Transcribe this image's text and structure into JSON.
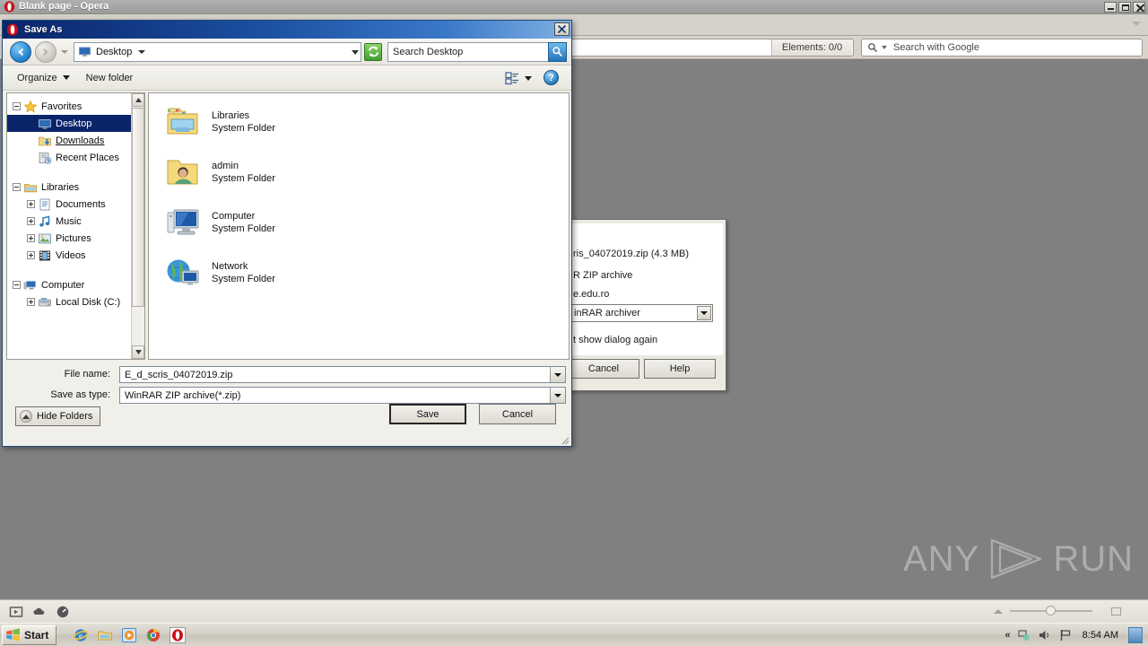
{
  "opera": {
    "title": "Blank page - Opera",
    "title_icon": "opera-logo-icon",
    "window_buttons": {
      "minimize": "minimize-icon",
      "maximize": "maximize-icon",
      "close": "close-icon"
    },
    "address_bar": {
      "value": "",
      "elements_badge": "Elements:  0/0"
    },
    "search": {
      "icon": "search-icon",
      "placeholder": "Search with Google"
    },
    "status_icons": [
      "media-icon",
      "cloud-icon",
      "speed-dial-icon"
    ],
    "zoom_value": "100%"
  },
  "watermark": {
    "left": "ANY",
    "right": "RUN"
  },
  "download_dialog": {
    "file_line": "ris_04072019.zip (4.3 MB)",
    "type_line": "R ZIP archive",
    "host_line": "e.edu.ro",
    "open_with": "inRAR archiver",
    "dont_show_again": "t show dialog again",
    "buttons": {
      "cancel": "Cancel",
      "help": "Help"
    }
  },
  "save_as": {
    "title": "Save As",
    "title_icon": "opera-logo-icon",
    "close_label": "close-icon",
    "nav": {
      "back": "back-arrow-icon",
      "forward": "forward-arrow-icon",
      "history_dropdown": "chevron-down-icon",
      "address_icon": "desktop-icon",
      "address_value": "Desktop",
      "refresh": "refresh-icon",
      "search_value": "Search Desktop",
      "search_button": "search-icon"
    },
    "toolbar": {
      "organize": "Organize",
      "new_folder": "New folder",
      "view_icon": "view-mode-icon",
      "help": "?"
    },
    "tree": [
      {
        "label": "Favorites",
        "icon": "star-icon",
        "indent": 0,
        "toggle": "minus",
        "selected": false,
        "link": false
      },
      {
        "label": "Desktop",
        "icon": "desktop-icon",
        "indent": 1,
        "toggle": "none",
        "selected": true,
        "link": false
      },
      {
        "label": "Downloads",
        "icon": "downloads-icon",
        "indent": 1,
        "toggle": "none",
        "selected": false,
        "link": true
      },
      {
        "label": "Recent Places",
        "icon": "recent-places-icon",
        "indent": 1,
        "toggle": "none",
        "selected": false,
        "link": false
      },
      {
        "label": "Libraries",
        "icon": "libraries-icon",
        "indent": 0,
        "toggle": "minus",
        "selected": false,
        "link": false
      },
      {
        "label": "Documents",
        "icon": "documents-icon",
        "indent": 1,
        "toggle": "plus",
        "selected": false,
        "link": false
      },
      {
        "label": "Music",
        "icon": "music-icon",
        "indent": 1,
        "toggle": "plus",
        "selected": false,
        "link": false
      },
      {
        "label": "Pictures",
        "icon": "pictures-icon",
        "indent": 1,
        "toggle": "plus",
        "selected": false,
        "link": false
      },
      {
        "label": "Videos",
        "icon": "videos-icon",
        "indent": 1,
        "toggle": "plus",
        "selected": false,
        "link": false
      },
      {
        "label": "Computer",
        "icon": "computer-icon",
        "indent": 0,
        "toggle": "minus",
        "selected": false,
        "link": false
      },
      {
        "label": "Local Disk (C:)",
        "icon": "harddisk-icon",
        "indent": 1,
        "toggle": "plus",
        "selected": false,
        "link": false
      }
    ],
    "files": [
      {
        "name": "Libraries",
        "sub": "System Folder",
        "icon": "libraries-folder-icon"
      },
      {
        "name": "admin",
        "sub": "System Folder",
        "icon": "user-folder-icon"
      },
      {
        "name": "Computer",
        "sub": "System Folder",
        "icon": "computer-monitor-icon"
      },
      {
        "name": "Network",
        "sub": "System Folder",
        "icon": "network-globe-icon"
      }
    ],
    "fields": {
      "file_name_label": "File name:",
      "file_name_value": "E_d_scris_04072019.zip",
      "save_type_label": "Save as type:",
      "save_type_value": "WinRAR ZIP archive(*.zip)"
    },
    "footer": {
      "hide_folders": "Hide Folders",
      "save": "Save",
      "cancel": "Cancel"
    }
  },
  "taskbar": {
    "start": "Start",
    "quicklaunch": [
      "internet-explorer-icon",
      "windows-explorer-icon",
      "media-player-icon",
      "chrome-icon",
      "opera-icon"
    ],
    "tray": {
      "chevron": "«",
      "network_icon": "network-icon",
      "volume_icon": "volume-icon",
      "flag_icon": "action-center-icon",
      "clock": "8:54 AM",
      "show_desktop": "show-desktop-icon"
    }
  },
  "colors": {
    "desktop": "#808080",
    "dialog_title_start": "#0a246a",
    "selection": "#0a246a",
    "accent_green": "#3f9e2f"
  }
}
